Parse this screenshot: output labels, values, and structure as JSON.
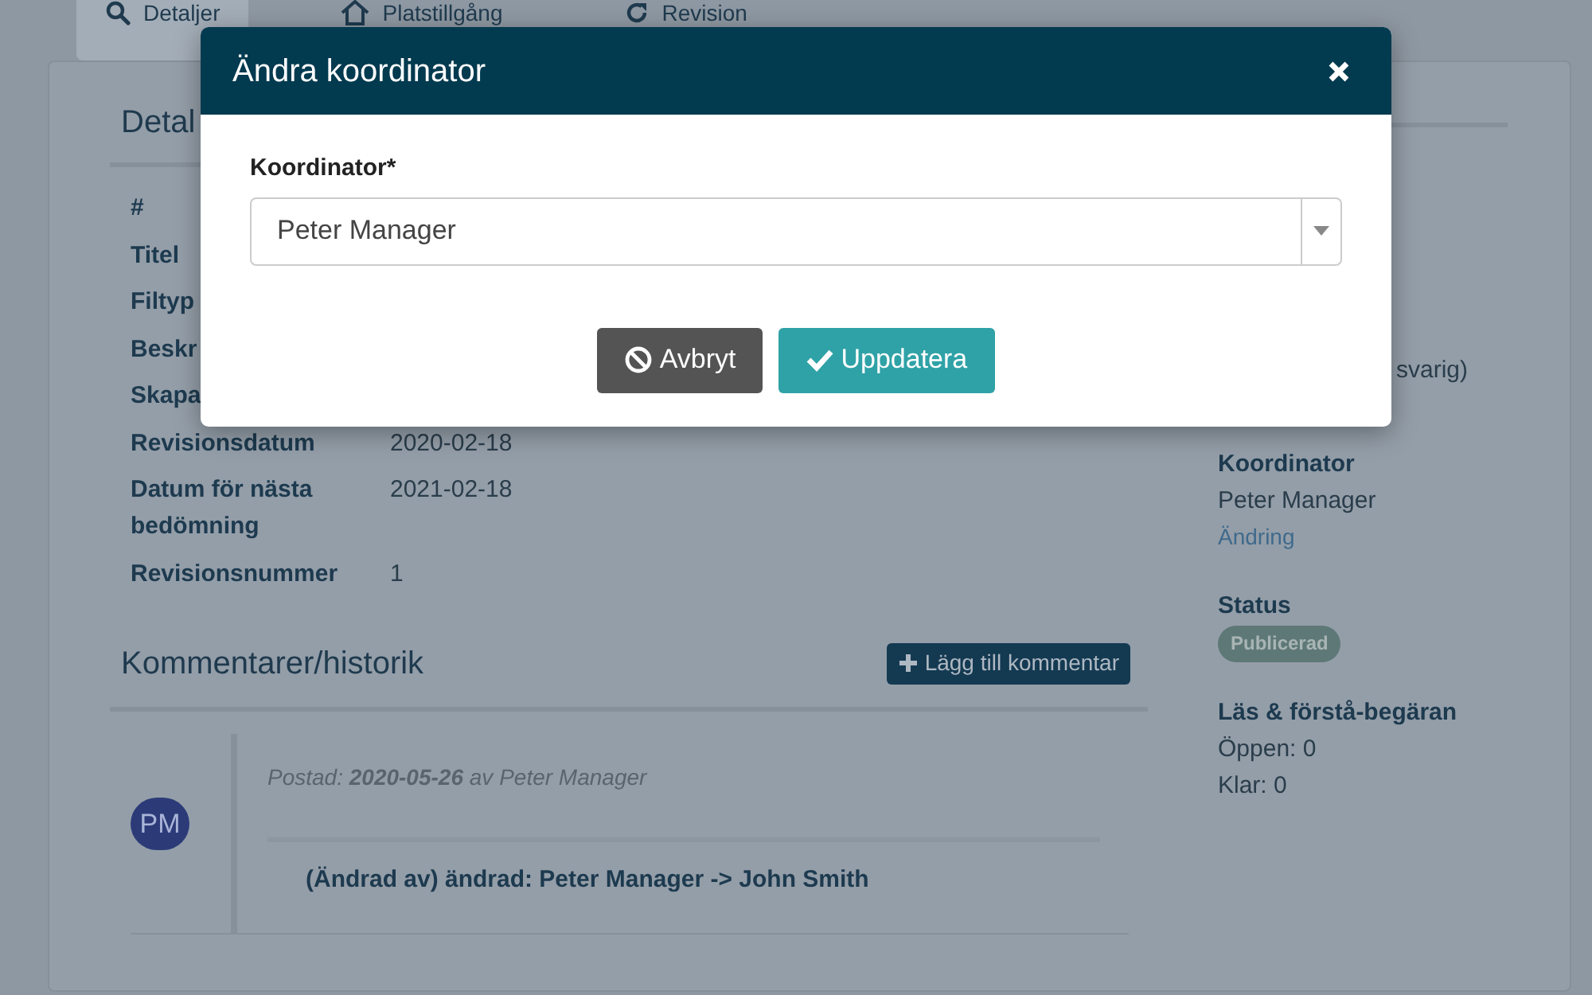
{
  "tabs": [
    {
      "label": "Detaljer",
      "selected": true
    },
    {
      "label": "Platstillgång",
      "selected": false
    },
    {
      "label": "Revision",
      "selected": false
    }
  ],
  "details": {
    "heading": "Detal",
    "fields": [
      {
        "label": "#"
      },
      {
        "label": "Titel"
      },
      {
        "label": "Filtyp"
      },
      {
        "label": "Beskr"
      },
      {
        "label": "Skapa"
      },
      {
        "label": "Revisionsdatum",
        "value": "2020-02-18"
      },
      {
        "label": "Datum för nästa bedömning",
        "value": "2021-02-18"
      },
      {
        "label": "Revisionsnummer",
        "value": "1"
      }
    ]
  },
  "comments": {
    "heading": "Kommentarer/historik",
    "add_button": "Lägg till kommentar",
    "items": [
      {
        "avatar": "PM",
        "posted": "Postad: **2020-05-26** av Peter Manager",
        "text": "(Ändrad av) ändrad: Peter Manager -> John Smith"
      }
    ]
  },
  "sidebar": {
    "partial_text": "svarig)",
    "sections": [
      {
        "kind": "text",
        "heading": "Koordinator",
        "lines": [
          "Peter Manager"
        ],
        "link": "Ändring"
      },
      {
        "kind": "badge",
        "heading": "Status",
        "badge": "Publicerad"
      },
      {
        "kind": "text",
        "heading": "Läs & förstå-begäran",
        "lines": [
          "Öppen: 0",
          "Klar: 0"
        ]
      }
    ]
  },
  "modal": {
    "title": "Ändra koordinator",
    "field": {
      "label": "Koordinator*",
      "value": "Peter Manager"
    },
    "buttons": [
      {
        "kind": "cancel",
        "label": "Avbryt"
      },
      {
        "kind": "confirm",
        "label": "Uppdatera"
      }
    ]
  }
}
